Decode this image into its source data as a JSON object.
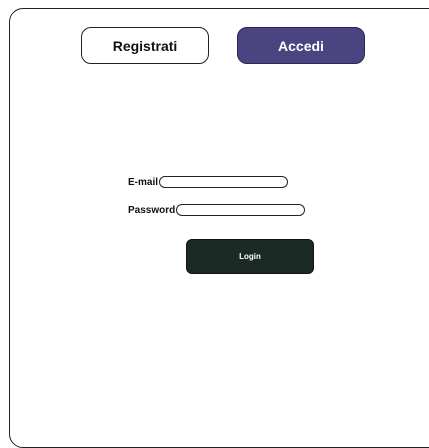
{
  "tabs": {
    "register_label": "Registrati",
    "login_label": "Accedi"
  },
  "form": {
    "email_label": "E-mail",
    "email_value": "",
    "password_label": "Password",
    "password_value": "",
    "submit_label": "Login"
  },
  "colors": {
    "login_tab_background": "#4a4480",
    "submit_background": "#1c2a26"
  }
}
